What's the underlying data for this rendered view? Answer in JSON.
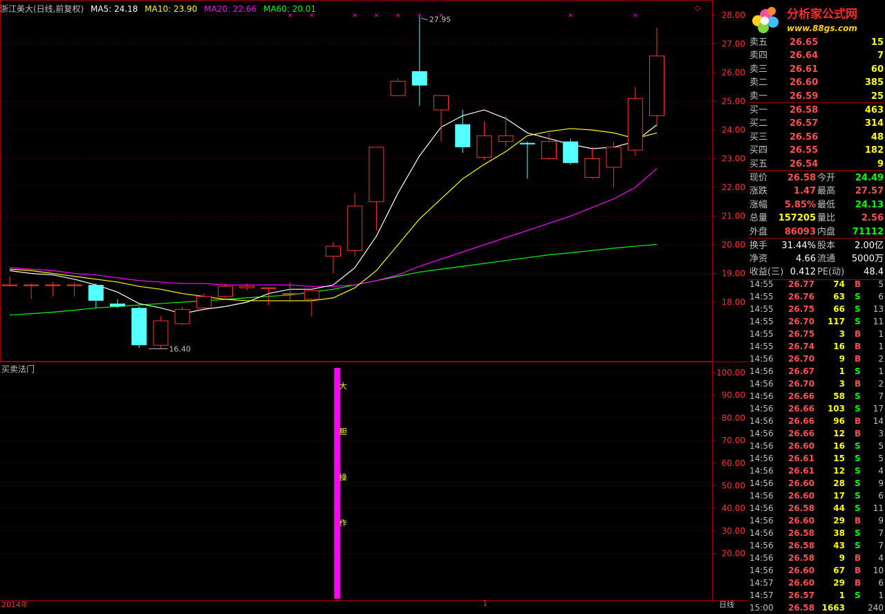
{
  "header": {
    "title": "浙江美大(日线,前复权)",
    "ma5": "MA5: 24.18",
    "ma10": "MA10: 23.90",
    "ma20": "MA20: 22.66",
    "ma60": "MA60: 20.01"
  },
  "colors": {
    "up": "#ff3232",
    "down": "#54ffff",
    "ma5": "#ffffff",
    "ma10": "#ffff00",
    "ma20": "#ff00ff",
    "ma60": "#00ff00",
    "grid": "#a00000",
    "bar": "#ff00ff"
  },
  "annotations": {
    "high": "27.95",
    "low": "16.40"
  },
  "indicator": {
    "title": "买卖法门",
    "signal_chars": [
      "大",
      "胆",
      "操",
      "作"
    ]
  },
  "bottom": {
    "year": "2014年",
    "mid": "1",
    "period": "日线"
  },
  "price_axis_labels": [
    "28.00",
    "27.00",
    "26.00",
    "25.00",
    "24.00",
    "23.00",
    "22.00",
    "21.00",
    "20.00",
    "19.00",
    "18.00"
  ],
  "ind_axis_labels": [
    "100.00",
    "90.00",
    "80.00",
    "70.00",
    "60.00",
    "50.00",
    "40.00",
    "30.00",
    "20.00"
  ],
  "chart_data": {
    "type": "candlestick",
    "candles": [
      {
        "o": 18.6,
        "h": 18.9,
        "l": 18.55,
        "c": 18.6
      },
      {
        "o": 18.6,
        "h": 18.65,
        "l": 18.1,
        "c": 18.6
      },
      {
        "o": 18.6,
        "h": 18.7,
        "l": 18.2,
        "c": 18.6
      },
      {
        "o": 18.6,
        "h": 18.7,
        "l": 18.2,
        "c": 18.6
      },
      {
        "o": 18.6,
        "h": 18.65,
        "l": 17.8,
        "c": 18.05
      },
      {
        "o": 17.95,
        "h": 18.1,
        "l": 17.8,
        "c": 17.85
      },
      {
        "o": 17.8,
        "h": 17.85,
        "l": 16.4,
        "c": 16.5
      },
      {
        "o": 16.5,
        "h": 17.5,
        "l": 16.4,
        "c": 17.35
      },
      {
        "o": 17.25,
        "h": 17.85,
        "l": 17.2,
        "c": 17.75
      },
      {
        "o": 17.8,
        "h": 18.3,
        "l": 17.7,
        "c": 18.2
      },
      {
        "o": 18.2,
        "h": 18.65,
        "l": 18.1,
        "c": 18.55
      },
      {
        "o": 18.5,
        "h": 18.65,
        "l": 18.4,
        "c": 18.55
      },
      {
        "o": 18.5,
        "h": 18.5,
        "l": 17.9,
        "c": 18.5
      },
      {
        "o": 18.3,
        "h": 18.7,
        "l": 18.0,
        "c": 18.3
      },
      {
        "o": 18.1,
        "h": 18.4,
        "l": 17.5,
        "c": 18.4
      },
      {
        "o": 19.6,
        "h": 20.1,
        "l": 19.0,
        "c": 19.95
      },
      {
        "o": 19.8,
        "h": 21.8,
        "l": 19.6,
        "c": 21.35
      },
      {
        "o": 21.5,
        "h": 23.4,
        "l": 20.5,
        "c": 23.4
      },
      {
        "o": 25.2,
        "h": 25.8,
        "l": 25.2,
        "c": 25.7
      },
      {
        "o": 26.05,
        "h": 27.95,
        "l": 24.85,
        "c": 25.55
      },
      {
        "o": 24.7,
        "h": 25.2,
        "l": 23.6,
        "c": 25.2
      },
      {
        "o": 24.2,
        "h": 24.7,
        "l": 23.2,
        "c": 23.4
      },
      {
        "o": 23.05,
        "h": 24.3,
        "l": 22.95,
        "c": 23.8
      },
      {
        "o": 23.6,
        "h": 24.5,
        "l": 23.4,
        "c": 23.8
      },
      {
        "o": 23.55,
        "h": 23.6,
        "l": 22.3,
        "c": 23.5
      },
      {
        "o": 23.0,
        "h": 23.9,
        "l": 22.95,
        "c": 23.6
      },
      {
        "o": 23.6,
        "h": 23.7,
        "l": 22.8,
        "c": 22.85
      },
      {
        "o": 22.35,
        "h": 23.4,
        "l": 22.3,
        "c": 23.0
      },
      {
        "o": 22.7,
        "h": 23.6,
        "l": 22.0,
        "c": 23.4
      },
      {
        "o": 23.3,
        "h": 25.5,
        "l": 23.1,
        "c": 25.1
      },
      {
        "o": 24.5,
        "h": 27.57,
        "l": 24.13,
        "c": 26.58
      }
    ],
    "ma5": [
      19.1,
      19.0,
      18.95,
      18.8,
      18.6,
      18.35,
      17.95,
      17.8,
      17.6,
      17.75,
      17.85,
      18.0,
      18.3,
      18.45,
      18.45,
      18.6,
      19.2,
      20.3,
      21.8,
      23.1,
      24.1,
      24.5,
      24.7,
      24.4,
      23.9,
      23.7,
      23.5,
      23.35,
      23.4,
      23.6,
      24.18
    ],
    "ma10": [
      19.15,
      19.1,
      19.0,
      18.9,
      18.8,
      18.7,
      18.55,
      18.45,
      18.3,
      18.2,
      18.1,
      18.05,
      18.05,
      18.05,
      18.05,
      18.15,
      18.5,
      19.1,
      20.0,
      20.9,
      21.6,
      22.3,
      22.8,
      23.25,
      23.8,
      23.95,
      24.05,
      24.0,
      23.9,
      23.7,
      23.9
    ],
    "ma20": [
      19.2,
      19.15,
      19.1,
      19.0,
      18.95,
      18.85,
      18.75,
      18.7,
      18.65,
      18.65,
      18.6,
      18.6,
      18.6,
      18.6,
      18.55,
      18.55,
      18.6,
      18.75,
      18.95,
      19.25,
      19.5,
      19.75,
      20.0,
      20.25,
      20.5,
      20.75,
      21.0,
      21.3,
      21.6,
      22.0,
      22.66
    ],
    "ma60": [
      17.55,
      17.6,
      17.65,
      17.72,
      17.8,
      17.85,
      17.9,
      17.95,
      18.0,
      18.05,
      18.1,
      18.15,
      18.2,
      18.25,
      18.35,
      18.45,
      18.6,
      18.75,
      18.9,
      19.05,
      19.15,
      19.25,
      19.35,
      19.45,
      19.55,
      19.65,
      19.72,
      19.8,
      19.88,
      19.95,
      20.01
    ],
    "price_range": [
      16.0,
      28.4
    ],
    "signal_index": 14,
    "signal_value": 100,
    "ind_range": [
      0,
      100
    ]
  },
  "quote": {
    "sell": [
      {
        "label": "卖五",
        "price": "26.65",
        "vol": "15"
      },
      {
        "label": "卖四",
        "price": "26.64",
        "vol": "7"
      },
      {
        "label": "卖三",
        "price": "26.61",
        "vol": "60"
      },
      {
        "label": "卖二",
        "price": "26.60",
        "vol": "385"
      },
      {
        "label": "卖一",
        "price": "26.59",
        "vol": "25"
      }
    ],
    "buy": [
      {
        "label": "买一",
        "price": "26.58",
        "vol": "463"
      },
      {
        "label": "买二",
        "price": "26.57",
        "vol": "314"
      },
      {
        "label": "买三",
        "price": "26.56",
        "vol": "48"
      },
      {
        "label": "买四",
        "price": "26.55",
        "vol": "182"
      },
      {
        "label": "买五",
        "price": "26.54",
        "vol": "9"
      }
    ],
    "stats": [
      {
        "l1": "现价",
        "v1": "26.58",
        "c1": "#ff5050",
        "l2": "今开",
        "v2": "24.49",
        "c2": "#00ff00"
      },
      {
        "l1": "涨跌",
        "v1": "1.47",
        "c1": "#ff5050",
        "l2": "最高",
        "v2": "27.57",
        "c2": "#ff5050"
      },
      {
        "l1": "涨幅",
        "v1": "5.85%",
        "c1": "#ff5050",
        "l2": "最低",
        "v2": "24.13",
        "c2": "#00ff00"
      },
      {
        "l1": "总量",
        "v1": "157205",
        "c1": "#ffff00",
        "l2": "量比",
        "v2": "2.56",
        "c2": "#ff5050"
      },
      {
        "l1": "外盘",
        "v1": "86093",
        "c1": "#ff5050",
        "l2": "内盘",
        "v2": "71112",
        "c2": "#00ff00"
      }
    ],
    "stats2": [
      {
        "l1": "换手",
        "v1": "31.44%",
        "l2": "股本",
        "v2": "2.00亿"
      },
      {
        "l1": "净资",
        "v1": "4.66",
        "l2": "流通",
        "v2": "5000万"
      },
      {
        "l1": "收益(三)",
        "v1": "0.412",
        "l2": "PE(动)",
        "v2": "48.4"
      }
    ]
  },
  "ticks": [
    {
      "t": "14:55",
      "p": "26.77",
      "v": "74",
      "s": "B",
      "n": "5"
    },
    {
      "t": "14:55",
      "p": "26.76",
      "v": "63",
      "s": "S",
      "n": "6"
    },
    {
      "t": "14:55",
      "p": "26.75",
      "v": "66",
      "s": "S",
      "n": "13"
    },
    {
      "t": "14:55",
      "p": "26.70",
      "v": "117",
      "s": "S",
      "n": "11"
    },
    {
      "t": "14:55",
      "p": "26.75",
      "v": "3",
      "s": "B",
      "n": "1"
    },
    {
      "t": "14:55",
      "p": "26.74",
      "v": "16",
      "s": "B",
      "n": "1"
    },
    {
      "t": "14:56",
      "p": "26.70",
      "v": "9",
      "s": "B",
      "n": "2"
    },
    {
      "t": "14:56",
      "p": "26.67",
      "v": "1",
      "s": "S",
      "n": "1"
    },
    {
      "t": "14:56",
      "p": "26.70",
      "v": "3",
      "s": "B",
      "n": "2"
    },
    {
      "t": "14:56",
      "p": "26.66",
      "v": "58",
      "s": "S",
      "n": "7"
    },
    {
      "t": "14:56",
      "p": "26.66",
      "v": "103",
      "s": "S",
      "n": "17"
    },
    {
      "t": "14:56",
      "p": "26.66",
      "v": "96",
      "s": "B",
      "n": "14"
    },
    {
      "t": "14:56",
      "p": "26.66",
      "v": "12",
      "s": "B",
      "n": "3"
    },
    {
      "t": "14:56",
      "p": "26.60",
      "v": "16",
      "s": "S",
      "n": "5"
    },
    {
      "t": "14:56",
      "p": "26.61",
      "v": "15",
      "s": "S",
      "n": "5"
    },
    {
      "t": "14:56",
      "p": "26.61",
      "v": "12",
      "s": "S",
      "n": "4"
    },
    {
      "t": "14:56",
      "p": "26.60",
      "v": "28",
      "s": "S",
      "n": "9"
    },
    {
      "t": "14:56",
      "p": "26.60",
      "v": "17",
      "s": "S",
      "n": "6"
    },
    {
      "t": "14:56",
      "p": "26.58",
      "v": "44",
      "s": "S",
      "n": "11"
    },
    {
      "t": "14:56",
      "p": "26.60",
      "v": "29",
      "s": "B",
      "n": "9"
    },
    {
      "t": "14:56",
      "p": "26.58",
      "v": "38",
      "s": "S",
      "n": "7"
    },
    {
      "t": "14:56",
      "p": "26.58",
      "v": "43",
      "s": "S",
      "n": "7"
    },
    {
      "t": "14:56",
      "p": "26.58",
      "v": "9",
      "s": "B",
      "n": "4"
    },
    {
      "t": "14:56",
      "p": "26.60",
      "v": "67",
      "s": "B",
      "n": "10"
    },
    {
      "t": "14:57",
      "p": "26.60",
      "v": "29",
      "s": "B",
      "n": "6"
    },
    {
      "t": "14:57",
      "p": "26.57",
      "v": "1",
      "s": "S",
      "n": "1"
    },
    {
      "t": "15:00",
      "p": "26.58",
      "v": "1663",
      "s": "",
      "n": "240"
    }
  ]
}
